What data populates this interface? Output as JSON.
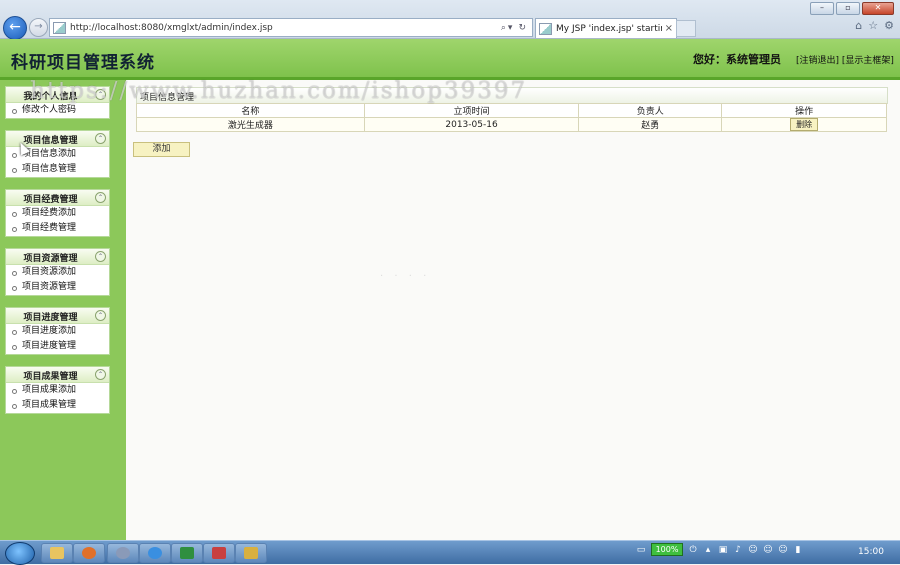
{
  "browser": {
    "url": "http://localhost:8080/xmglxt/admin/index.jsp",
    "tab_title": "My JSP 'index.jsp' startin..."
  },
  "header": {
    "title": "科研项目管理系统",
    "greeting": "您好：系统管理员",
    "logout_link": "[注销退出]",
    "home_link": "[显示主框架]"
  },
  "sidebar": {
    "panels": [
      {
        "title": "我的个人信息",
        "items": [
          "修改个人密码"
        ]
      },
      {
        "title": "项目信息管理",
        "items": [
          "项目信息添加",
          "项目信息管理"
        ]
      },
      {
        "title": "项目经费管理",
        "items": [
          "项目经费添加",
          "项目经费管理"
        ]
      },
      {
        "title": "项目资源管理",
        "items": [
          "项目资源添加",
          "项目资源管理"
        ]
      },
      {
        "title": "项目进度管理",
        "items": [
          "项目进度添加",
          "项目进度管理"
        ]
      },
      {
        "title": "项目成果管理",
        "items": [
          "项目成果添加",
          "项目成果管理"
        ]
      }
    ]
  },
  "main": {
    "section_title": "项目信息管理",
    "columns": [
      "名称",
      "立项时间",
      "负责人",
      "操作"
    ],
    "rows": [
      {
        "name": "激光生成器",
        "date": "2013-05-16",
        "owner": "赵勇",
        "action": "删除"
      }
    ],
    "add_label": "添加"
  },
  "watermark": "https://www.huzhan.com/ishop39397",
  "taskbar": {
    "battery": "100%",
    "clock": "15:00"
  },
  "colors": {
    "header_green": "#8cc85a",
    "sidebar_green": "#8cc85a",
    "button_yellow": "#f7f2c2"
  }
}
